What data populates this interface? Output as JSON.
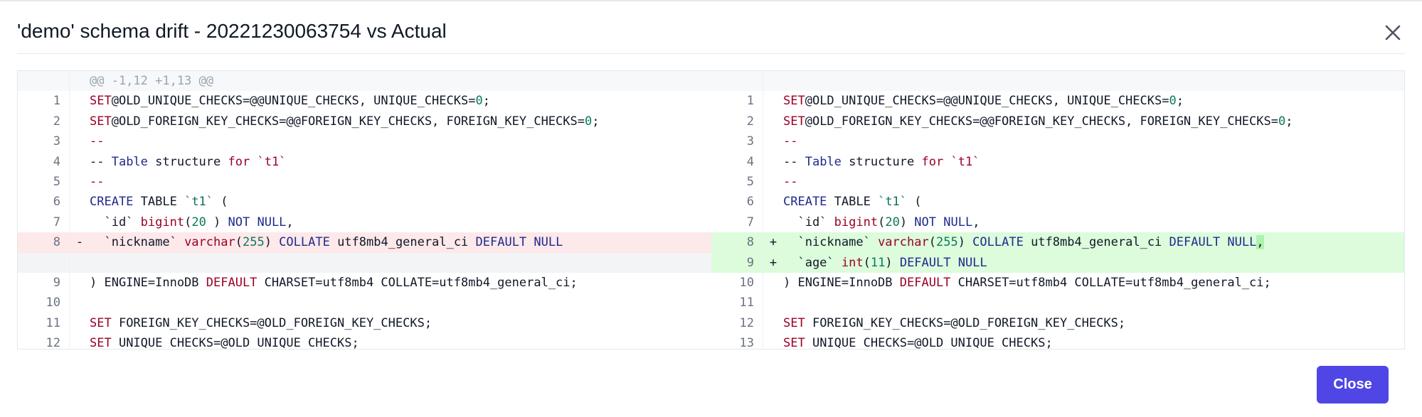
{
  "dialog": {
    "title": "'demo' schema drift - 20221230063754 vs Actual",
    "close_label": "Close"
  },
  "diff": {
    "hunk_header": "@@ -1,12 +1,13 @@",
    "left": [
      {
        "n": "1",
        "type": "ctx",
        "segs": [
          [
            "kw",
            "SET"
          ],
          [
            "",
            "@OLD_UNIQUE_CHECKS=@@UNIQUE_CHECKS, UNIQUE_CHECKS="
          ],
          [
            "nm",
            "0"
          ],
          [
            "",
            ";"
          ]
        ]
      },
      {
        "n": "2",
        "type": "ctx",
        "segs": [
          [
            "kw",
            "SET"
          ],
          [
            "",
            "@OLD_FOREIGN_KEY_CHECKS=@@FOREIGN_KEY_CHECKS, FOREIGN_KEY_CHECKS="
          ],
          [
            "nm",
            "0"
          ],
          [
            "",
            ";"
          ]
        ]
      },
      {
        "n": "3",
        "type": "ctx",
        "segs": [
          [
            "kw",
            "--"
          ]
        ]
      },
      {
        "n": "4",
        "type": "ctx",
        "segs": [
          [
            "",
            "-- "
          ],
          [
            "tp",
            "Table"
          ],
          [
            "",
            " structure "
          ],
          [
            "kw",
            "for"
          ],
          [
            "",
            " "
          ],
          [
            "kw",
            "`t1`"
          ]
        ]
      },
      {
        "n": "5",
        "type": "ctx",
        "segs": [
          [
            "kw",
            "--"
          ]
        ]
      },
      {
        "n": "6",
        "type": "ctx",
        "segs": [
          [
            "tp",
            "CREATE"
          ],
          [
            "",
            " TABLE "
          ],
          [
            "bt",
            "`t1`"
          ],
          [
            "",
            " ("
          ]
        ]
      },
      {
        "n": "7",
        "type": "ctx",
        "segs": [
          [
            "",
            "  `id` "
          ],
          [
            "kw",
            "bigint"
          ],
          [
            "",
            "("
          ],
          [
            "nm",
            "20"
          ],
          [
            "",
            " ) "
          ],
          [
            "tp",
            "NOT NULL"
          ],
          [
            "",
            ","
          ]
        ]
      },
      {
        "n": "8",
        "type": "del",
        "mark": "-",
        "segs": [
          [
            "",
            "  `nickname` "
          ],
          [
            "kw",
            "varchar"
          ],
          [
            "",
            "("
          ],
          [
            "nm",
            "255"
          ],
          [
            "",
            ") "
          ],
          [
            "tp",
            "COLLATE"
          ],
          [
            "",
            " utf8mb4_general_ci "
          ],
          [
            "tp",
            "DEFAULT NULL"
          ]
        ]
      },
      {
        "n": "",
        "type": "empty",
        "segs": []
      },
      {
        "n": "9",
        "type": "ctx",
        "segs": [
          [
            "",
            ") ENGINE=InnoDB "
          ],
          [
            "kw",
            "DEFAULT"
          ],
          [
            "",
            " CHARSET=utf8mb4 COLLATE=utf8mb4_general_ci;"
          ]
        ]
      },
      {
        "n": "10",
        "type": "ctx",
        "segs": []
      },
      {
        "n": "11",
        "type": "ctx",
        "segs": [
          [
            "kw",
            "SET"
          ],
          [
            "",
            " FOREIGN_KEY_CHECKS=@OLD_FOREIGN_KEY_CHECKS;"
          ]
        ]
      },
      {
        "n": "12",
        "type": "ctx",
        "segs": [
          [
            "kw",
            "SET"
          ],
          [
            "",
            " UNIQUE_CHECKS=@OLD_UNIQUE_CHECKS;"
          ]
        ]
      }
    ],
    "right": [
      {
        "n": "1",
        "type": "ctx",
        "segs": [
          [
            "kw",
            "SET"
          ],
          [
            "",
            "@OLD_UNIQUE_CHECKS=@@UNIQUE_CHECKS, UNIQUE_CHECKS="
          ],
          [
            "nm",
            "0"
          ],
          [
            "",
            ";"
          ]
        ]
      },
      {
        "n": "2",
        "type": "ctx",
        "segs": [
          [
            "kw",
            "SET"
          ],
          [
            "",
            "@OLD_FOREIGN_KEY_CHECKS=@@FOREIGN_KEY_CHECKS, FOREIGN_KEY_CHECKS="
          ],
          [
            "nm",
            "0"
          ],
          [
            "",
            ";"
          ]
        ]
      },
      {
        "n": "3",
        "type": "ctx",
        "segs": [
          [
            "kw",
            "--"
          ]
        ]
      },
      {
        "n": "4",
        "type": "ctx",
        "segs": [
          [
            "",
            "-- "
          ],
          [
            "tp",
            "Table"
          ],
          [
            "",
            " structure "
          ],
          [
            "kw",
            "for"
          ],
          [
            "",
            " "
          ],
          [
            "kw",
            "`t1`"
          ]
        ]
      },
      {
        "n": "5",
        "type": "ctx",
        "segs": [
          [
            "kw",
            "--"
          ]
        ]
      },
      {
        "n": "6",
        "type": "ctx",
        "segs": [
          [
            "tp",
            "CREATE"
          ],
          [
            "",
            " TABLE "
          ],
          [
            "bt",
            "`t1`"
          ],
          [
            "",
            " ("
          ]
        ]
      },
      {
        "n": "7",
        "type": "ctx",
        "segs": [
          [
            "",
            "  `id` "
          ],
          [
            "kw",
            "bigint"
          ],
          [
            "",
            "("
          ],
          [
            "nm",
            "20"
          ],
          [
            "",
            ") "
          ],
          [
            "tp",
            "NOT NULL"
          ],
          [
            "",
            ","
          ]
        ]
      },
      {
        "n": "8",
        "type": "add",
        "mark": "+",
        "segs": [
          [
            "",
            "  `nickname` "
          ],
          [
            "kw",
            "varchar"
          ],
          [
            "",
            "("
          ],
          [
            "nm",
            "255"
          ],
          [
            "",
            ") "
          ],
          [
            "tp",
            "COLLATE"
          ],
          [
            "",
            " utf8mb4_general_ci "
          ],
          [
            "tp",
            "DEFAULT NULL"
          ],
          [
            "hl",
            ","
          ]
        ]
      },
      {
        "n": "9",
        "type": "add",
        "mark": "+",
        "segs": [
          [
            "",
            "  `age` "
          ],
          [
            "kw",
            "int"
          ],
          [
            "",
            "("
          ],
          [
            "nm",
            "11"
          ],
          [
            "",
            ") "
          ],
          [
            "tp",
            "DEFAULT NULL"
          ]
        ]
      },
      {
        "n": "10",
        "type": "ctx",
        "segs": [
          [
            "",
            ") ENGINE=InnoDB "
          ],
          [
            "kw",
            "DEFAULT"
          ],
          [
            "",
            " CHARSET=utf8mb4 COLLATE=utf8mb4_general_ci;"
          ]
        ]
      },
      {
        "n": "11",
        "type": "ctx",
        "segs": []
      },
      {
        "n": "12",
        "type": "ctx",
        "segs": [
          [
            "kw",
            "SET"
          ],
          [
            "",
            " FOREIGN_KEY_CHECKS=@OLD_FOREIGN_KEY_CHECKS;"
          ]
        ]
      },
      {
        "n": "13",
        "type": "ctx",
        "segs": [
          [
            "kw",
            "SET"
          ],
          [
            "",
            " UNIQUE_CHECKS=@OLD_UNIQUE_CHECKS;"
          ]
        ]
      }
    ]
  }
}
